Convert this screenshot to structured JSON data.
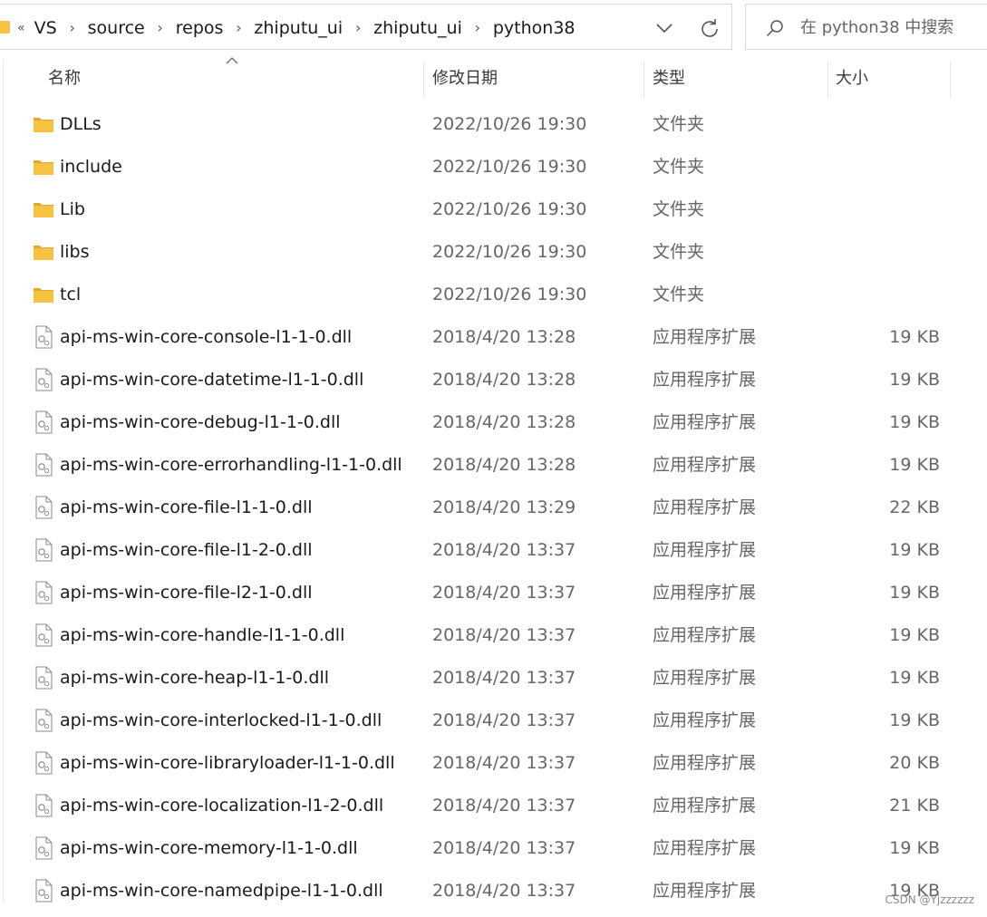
{
  "address_bar": {
    "prefix": "«",
    "crumbs": [
      "VS",
      "source",
      "repos",
      "zhiputu_ui",
      "zhiputu_ui",
      "python38"
    ]
  },
  "search": {
    "placeholder": "在 python38 中搜索"
  },
  "columns": {
    "name": "名称",
    "date": "修改日期",
    "type": "类型",
    "size": "大小"
  },
  "files": [
    {
      "name": "DLLs",
      "date": "2022/10/26 19:30",
      "type": "文件夹",
      "size": "",
      "kind": "folder-icon"
    },
    {
      "name": "include",
      "date": "2022/10/26 19:30",
      "type": "文件夹",
      "size": "",
      "kind": "folder-icon"
    },
    {
      "name": "Lib",
      "date": "2022/10/26 19:30",
      "type": "文件夹",
      "size": "",
      "kind": "folder-icon"
    },
    {
      "name": "libs",
      "date": "2022/10/26 19:30",
      "type": "文件夹",
      "size": "",
      "kind": "folder-icon"
    },
    {
      "name": "tcl",
      "date": "2022/10/26 19:30",
      "type": "文件夹",
      "size": "",
      "kind": "folder-icon"
    },
    {
      "name": "api-ms-win-core-console-l1-1-0.dll",
      "date": "2018/4/20 13:28",
      "type": "应用程序扩展",
      "size": "19 KB",
      "kind": "dll-file-icon"
    },
    {
      "name": "api-ms-win-core-datetime-l1-1-0.dll",
      "date": "2018/4/20 13:28",
      "type": "应用程序扩展",
      "size": "19 KB",
      "kind": "dll-file-icon"
    },
    {
      "name": "api-ms-win-core-debug-l1-1-0.dll",
      "date": "2018/4/20 13:28",
      "type": "应用程序扩展",
      "size": "19 KB",
      "kind": "dll-file-icon"
    },
    {
      "name": "api-ms-win-core-errorhandling-l1-1-0.dll",
      "date": "2018/4/20 13:28",
      "type": "应用程序扩展",
      "size": "19 KB",
      "kind": "dll-file-icon"
    },
    {
      "name": "api-ms-win-core-file-l1-1-0.dll",
      "date": "2018/4/20 13:29",
      "type": "应用程序扩展",
      "size": "22 KB",
      "kind": "dll-file-icon"
    },
    {
      "name": "api-ms-win-core-file-l1-2-0.dll",
      "date": "2018/4/20 13:37",
      "type": "应用程序扩展",
      "size": "19 KB",
      "kind": "dll-file-icon"
    },
    {
      "name": "api-ms-win-core-file-l2-1-0.dll",
      "date": "2018/4/20 13:37",
      "type": "应用程序扩展",
      "size": "19 KB",
      "kind": "dll-file-icon"
    },
    {
      "name": "api-ms-win-core-handle-l1-1-0.dll",
      "date": "2018/4/20 13:37",
      "type": "应用程序扩展",
      "size": "19 KB",
      "kind": "dll-file-icon"
    },
    {
      "name": "api-ms-win-core-heap-l1-1-0.dll",
      "date": "2018/4/20 13:37",
      "type": "应用程序扩展",
      "size": "19 KB",
      "kind": "dll-file-icon"
    },
    {
      "name": "api-ms-win-core-interlocked-l1-1-0.dll",
      "date": "2018/4/20 13:37",
      "type": "应用程序扩展",
      "size": "19 KB",
      "kind": "dll-file-icon"
    },
    {
      "name": "api-ms-win-core-libraryloader-l1-1-0.dll",
      "date": "2018/4/20 13:37",
      "type": "应用程序扩展",
      "size": "20 KB",
      "kind": "dll-file-icon"
    },
    {
      "name": "api-ms-win-core-localization-l1-2-0.dll",
      "date": "2018/4/20 13:37",
      "type": "应用程序扩展",
      "size": "21 KB",
      "kind": "dll-file-icon"
    },
    {
      "name": "api-ms-win-core-memory-l1-1-0.dll",
      "date": "2018/4/20 13:37",
      "type": "应用程序扩展",
      "size": "19 KB",
      "kind": "dll-file-icon"
    },
    {
      "name": "api-ms-win-core-namedpipe-l1-1-0.dll",
      "date": "2018/4/20 13:37",
      "type": "应用程序扩展",
      "size": "19 KB",
      "kind": "dll-file-icon"
    }
  ],
  "watermark": "CSDN @Yjzzzzzz",
  "colors": {
    "folder": "#f5c242",
    "folder_dark": "#e0a82e",
    "border": "#d9d9d9",
    "text_secondary": "#666666"
  }
}
